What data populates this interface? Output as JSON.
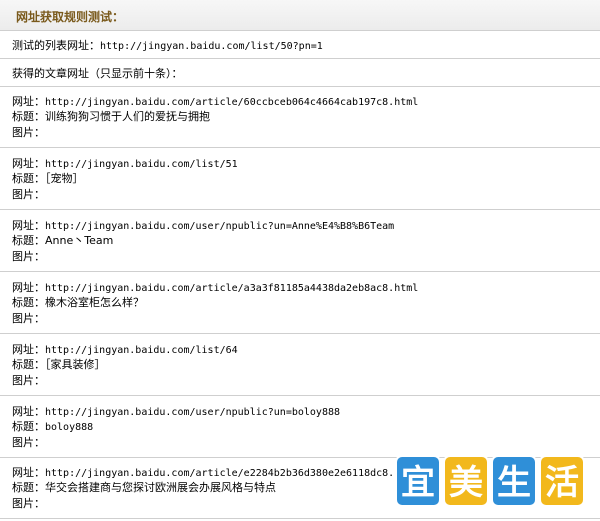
{
  "header": {
    "title": "网址获取规则测试："
  },
  "list_url": {
    "label": "测试的列表网址：",
    "url": "http://jingyan.baidu.com/list/50?pn=1"
  },
  "results_label": "获得的文章网址（只显示前十条）：",
  "field_labels": {
    "url": "网址：",
    "title": "标题：",
    "image": "图片："
  },
  "entries": [
    {
      "url": "http://jingyan.baidu.com/article/60ccbceb064c4664cab197c8.html",
      "title": "训练狗狗习惯于人们的爱抚与拥抱"
    },
    {
      "url": "http://jingyan.baidu.com/list/51",
      "title": "［宠物］"
    },
    {
      "url": "http://jingyan.baidu.com/user/npublic?un=Anne%E4%B8%B6Team",
      "title": "Anne丶Team"
    },
    {
      "url": "http://jingyan.baidu.com/article/a3a3f81185a4438da2eb8ac8.html",
      "title": "橡木浴室柜怎么样？"
    },
    {
      "url": "http://jingyan.baidu.com/list/64",
      "title": "［家具装修］"
    },
    {
      "url": "http://jingyan.baidu.com/user/npublic?un=boloy888",
      "title": "boloy888"
    },
    {
      "url": "http://jingyan.baidu.com/article/e2284b2b36d380e2e6118dc8.html",
      "title": "华交会搭建商与您探讨欧洲展会办展风格与特点"
    }
  ],
  "watermark": {
    "text": "宜美生活",
    "chars": [
      "宜",
      "美",
      "生",
      "活"
    ],
    "colors": {
      "tile_blue": "#2f8fd8",
      "tile_yellow": "#f2b81c",
      "outline": "#ffffff"
    }
  }
}
